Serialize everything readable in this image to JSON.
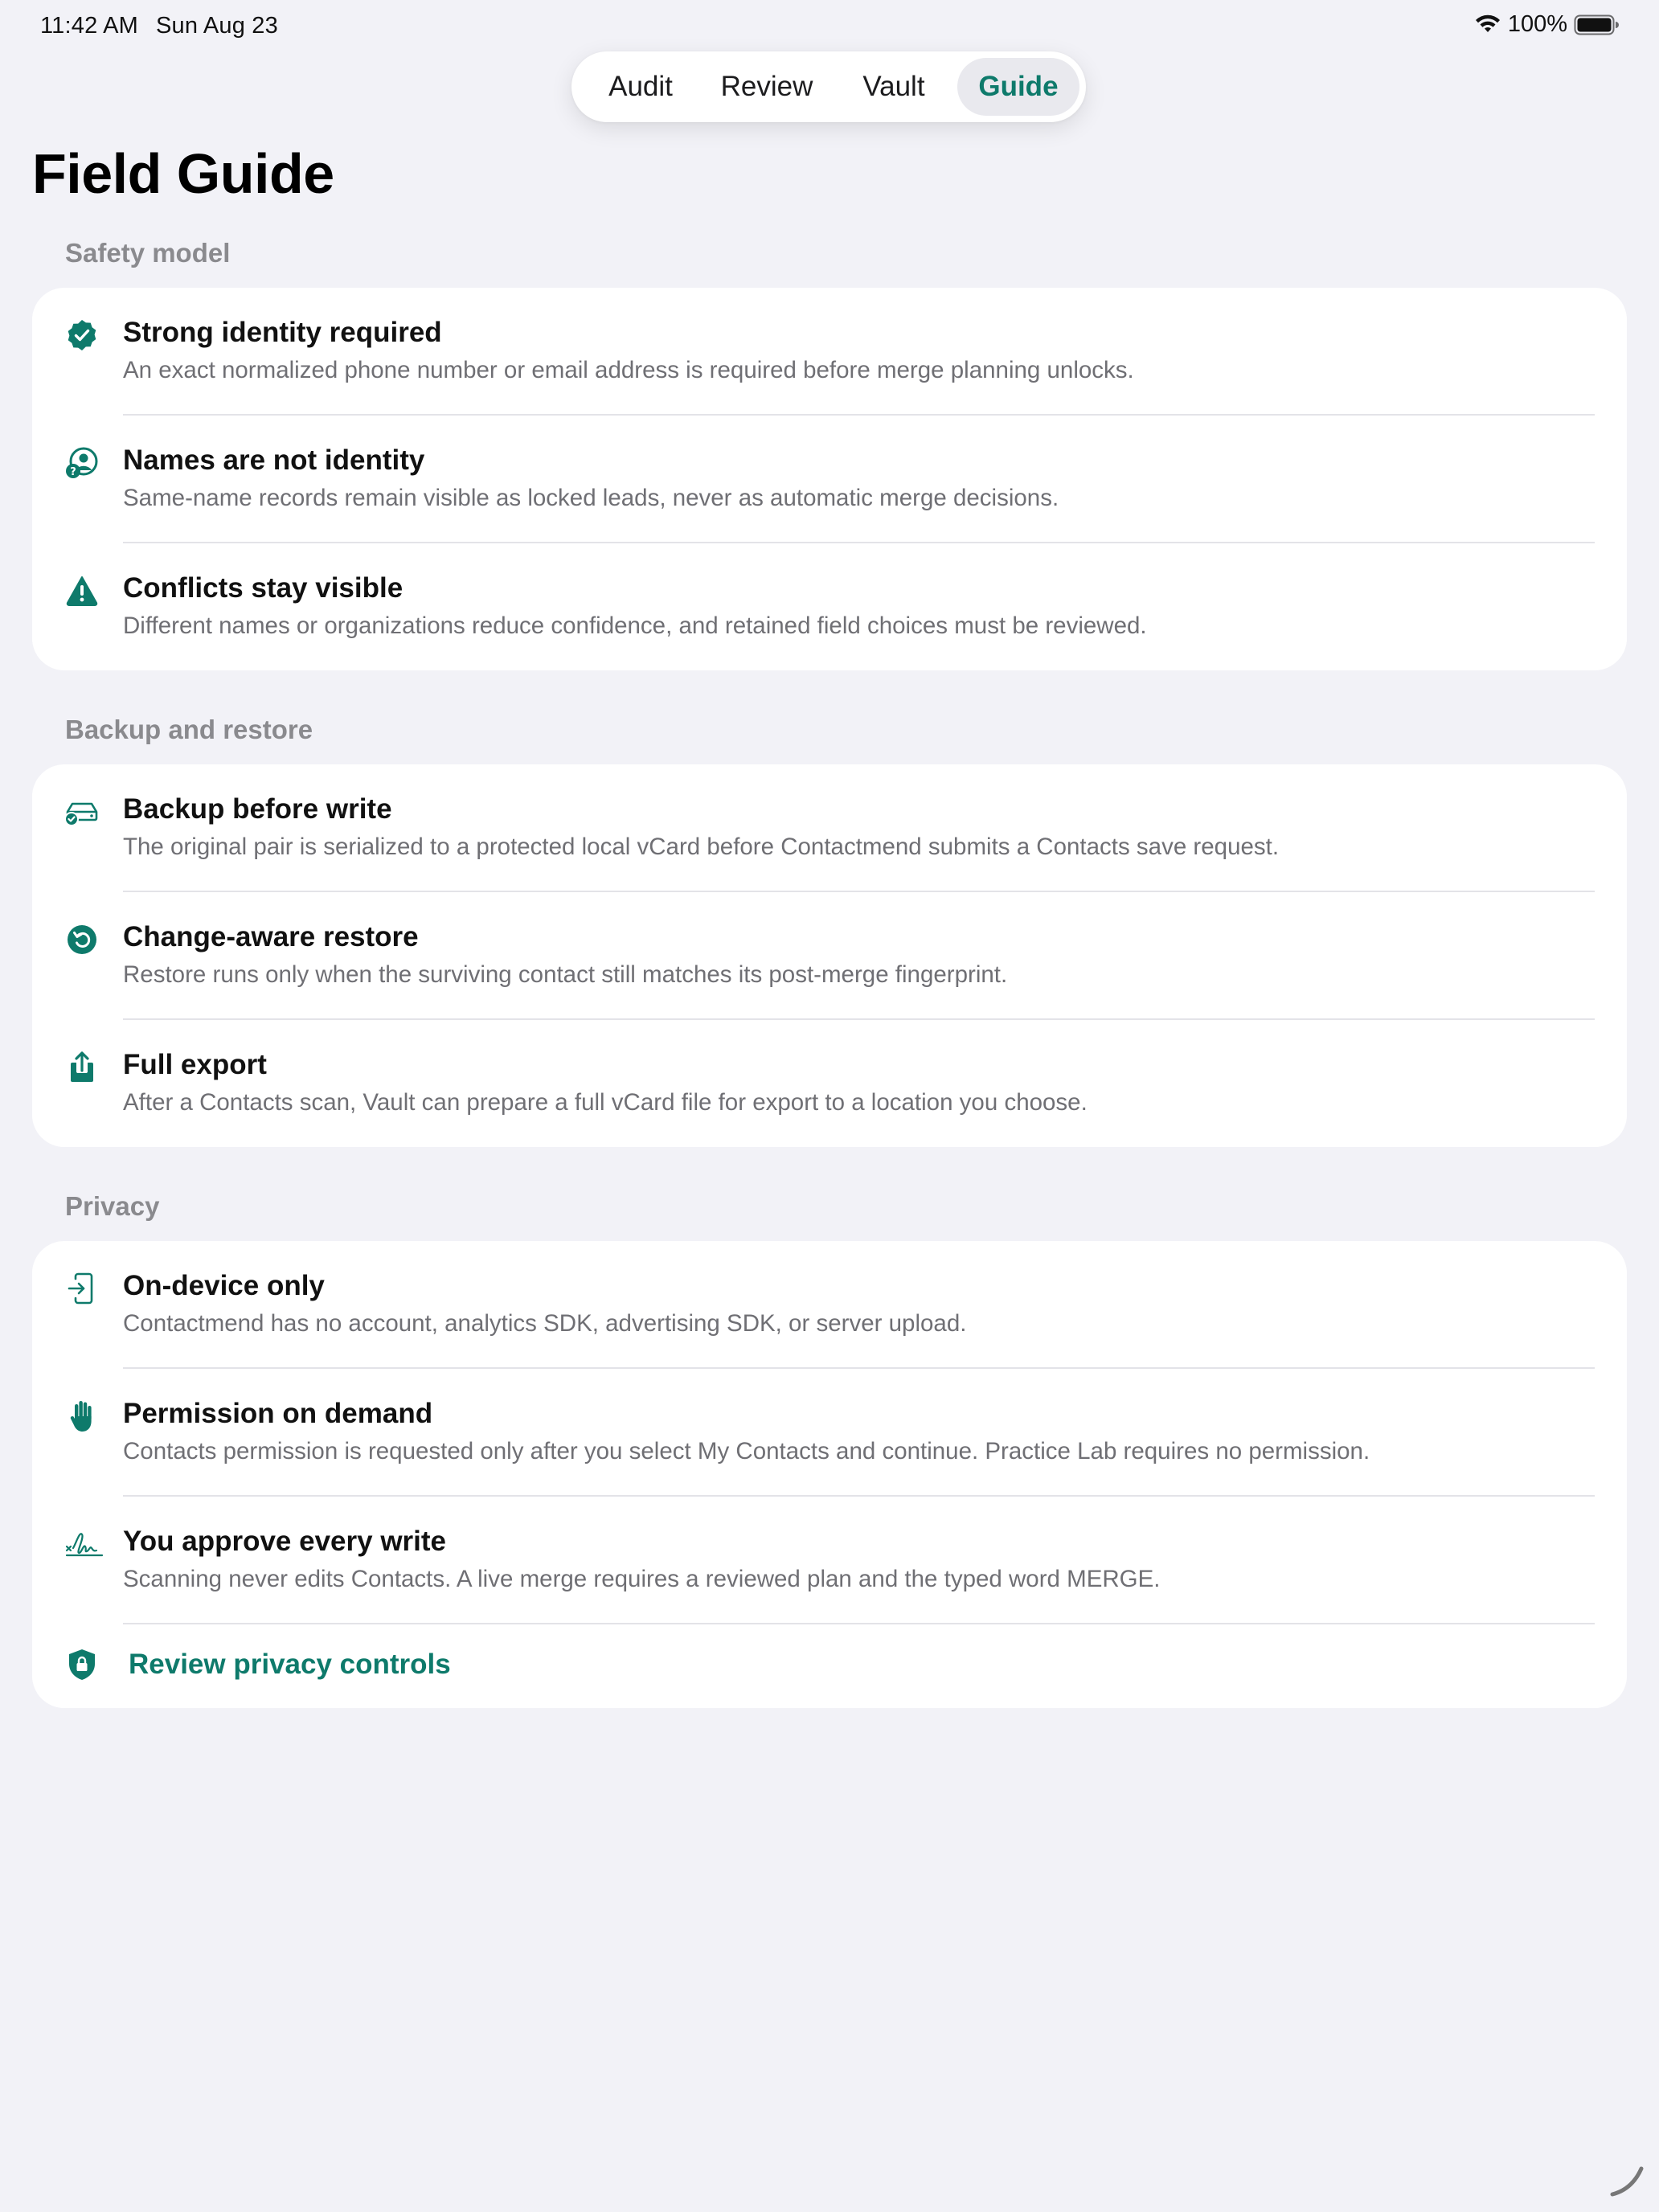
{
  "status_bar": {
    "time": "11:42 AM",
    "date": "Sun Aug 23",
    "battery": "100%"
  },
  "tabs": [
    {
      "label": "Audit",
      "active": false
    },
    {
      "label": "Review",
      "active": false
    },
    {
      "label": "Vault",
      "active": false
    },
    {
      "label": "Guide",
      "active": true
    }
  ],
  "page_title": "Field Guide",
  "colors": {
    "accent": "#0e7a6b",
    "background": "#f2f2f7"
  },
  "sections": [
    {
      "header": "Safety model",
      "items": [
        {
          "icon": "checkmark-seal-icon",
          "title": "Strong identity required",
          "description": "An exact normalized phone number or email address is required before merge planning unlocks."
        },
        {
          "icon": "person-question-icon",
          "title": "Names are not identity",
          "description": "Same-name records remain visible as locked leads, never as automatic merge decisions."
        },
        {
          "icon": "warning-triangle-icon",
          "title": "Conflicts stay visible",
          "description": "Different names or organizations reduce confidence, and retained field choices must be reviewed."
        }
      ]
    },
    {
      "header": "Backup and restore",
      "items": [
        {
          "icon": "external-drive-check-icon",
          "title": "Backup before write",
          "description": "The original pair is serialized to a protected local vCard before Contactmend submits a Contacts save request."
        },
        {
          "icon": "restore-arrow-icon",
          "title": "Change-aware restore",
          "description": "Restore runs only when the surviving contact still matches its post-merge fingerprint."
        },
        {
          "icon": "share-export-icon",
          "title": "Full export",
          "description": "After a Contacts scan, Vault can prepare a full vCard file for export to a location you choose."
        }
      ]
    },
    {
      "header": "Privacy",
      "items": [
        {
          "icon": "device-enter-icon",
          "title": "On-device only",
          "description": "Contactmend has no account, analytics SDK, advertising SDK, or server upload."
        },
        {
          "icon": "raised-hand-icon",
          "title": "Permission on demand",
          "description": "Contacts permission is requested only after you select My Contacts and continue. Practice Lab requires no permission."
        },
        {
          "icon": "signature-icon",
          "title": "You approve every write",
          "description": "Scanning never edits Contacts. A live merge requires a reviewed plan and the typed word MERGE."
        }
      ],
      "link": {
        "icon": "lock-shield-icon",
        "label": "Review privacy controls"
      }
    }
  ]
}
